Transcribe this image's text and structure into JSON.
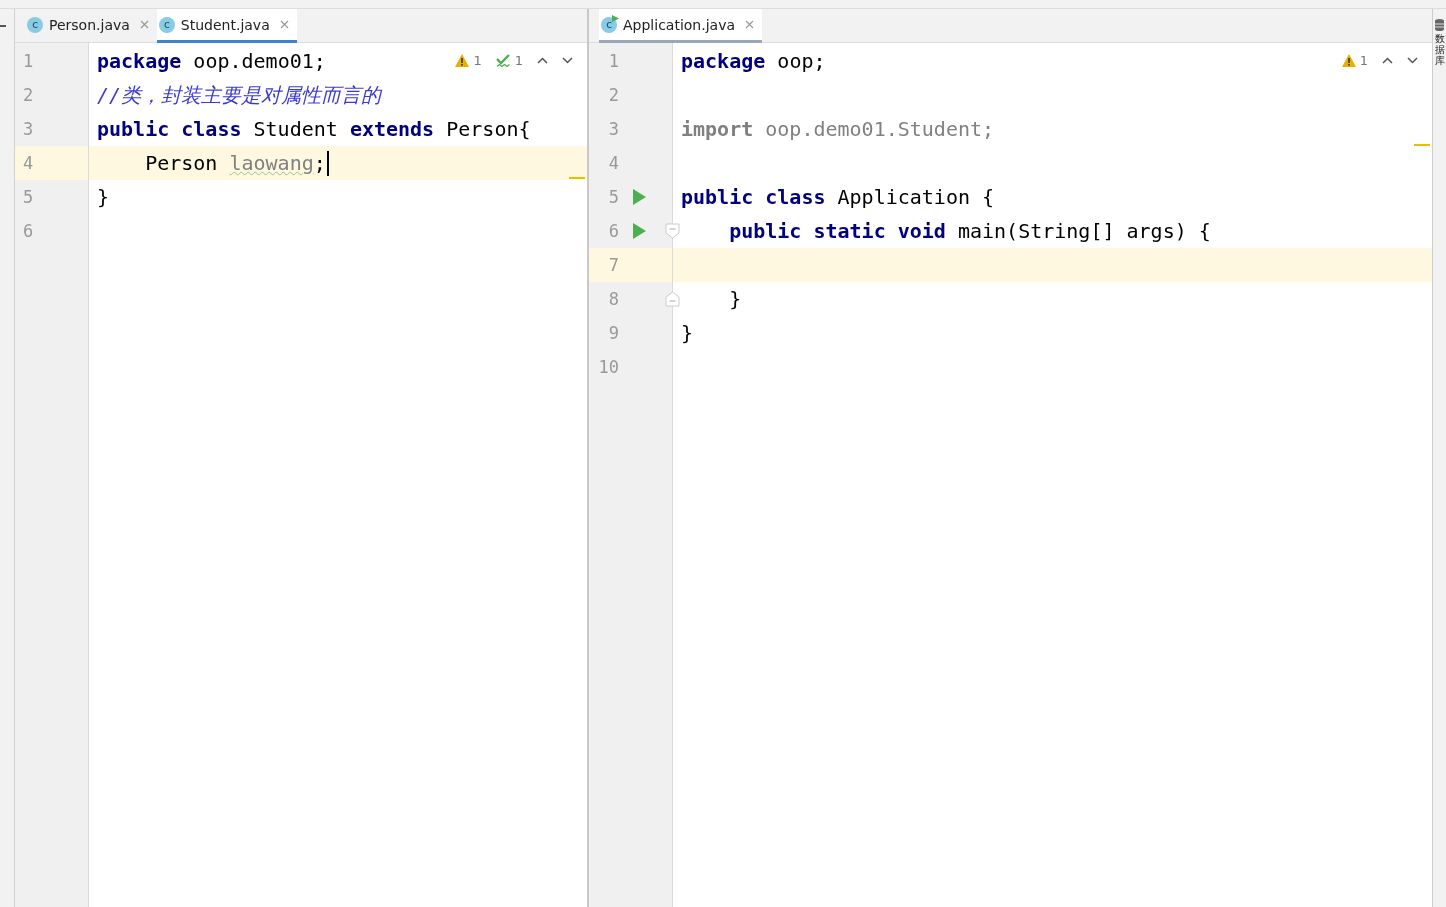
{
  "panes": [
    {
      "focused": true,
      "tabs": [
        {
          "label": "Person.java",
          "icon_text": "c",
          "runnable": false,
          "selected": false
        },
        {
          "label": "Student.java",
          "icon_text": "c",
          "runnable": false,
          "selected": true
        }
      ],
      "inspections": [
        {
          "kind": "warning",
          "count": "1"
        },
        {
          "kind": "typo",
          "count": "1"
        }
      ],
      "lines": [
        {
          "number": "1",
          "current": false,
          "tokens": [
            {
              "kind": "keyword",
              "text": "package"
            },
            {
              "kind": "text",
              "text": " oop.demo01;"
            }
          ]
        },
        {
          "number": "2",
          "current": false,
          "tokens": [
            {
              "kind": "comment",
              "text": "//类，封装主要是对属性而言的"
            }
          ]
        },
        {
          "number": "3",
          "current": false,
          "tokens": [
            {
              "kind": "keyword",
              "text": "public class"
            },
            {
              "kind": "text",
              "text": " Student "
            },
            {
              "kind": "keyword",
              "text": "extends"
            },
            {
              "kind": "text",
              "text": " Person{"
            }
          ]
        },
        {
          "number": "4",
          "current": true,
          "caret": true,
          "tokens": [
            {
              "kind": "text",
              "text": "    Person "
            },
            {
              "kind": "unused_typo",
              "text": "laowang"
            },
            {
              "kind": "text",
              "text": ";"
            }
          ]
        },
        {
          "number": "5",
          "current": false,
          "tokens": [
            {
              "kind": "text",
              "text": "}"
            }
          ]
        },
        {
          "number": "6",
          "current": false
        }
      ]
    },
    {
      "focused": false,
      "tabs": [
        {
          "label": "Application.java",
          "icon_text": "c",
          "runnable": true,
          "selected": true
        }
      ],
      "inspections": [
        {
          "kind": "warning",
          "count": "1"
        }
      ],
      "lines": [
        {
          "number": "1",
          "current": false,
          "tokens": [
            {
              "kind": "keyword",
              "text": "package"
            },
            {
              "kind": "text",
              "text": " oop;"
            }
          ]
        },
        {
          "number": "2",
          "current": false
        },
        {
          "number": "3",
          "current": false,
          "tokens": [
            {
              "kind": "unused_keyword",
              "text": "import"
            },
            {
              "kind": "unused",
              "text": " oop.demo01.Student;"
            }
          ]
        },
        {
          "number": "4",
          "current": false
        },
        {
          "number": "5",
          "current": false,
          "run": true,
          "tokens": [
            {
              "kind": "keyword",
              "text": "public class"
            },
            {
              "kind": "text",
              "text": " Application {"
            }
          ]
        },
        {
          "number": "6",
          "current": false,
          "run": true,
          "fold_start": true,
          "tokens": [
            {
              "kind": "keyword",
              "text": "    public static void"
            },
            {
              "kind": "text",
              "text": " main(String[] args) {"
            }
          ]
        },
        {
          "number": "7",
          "current": true
        },
        {
          "number": "8",
          "current": false,
          "fold_end": true,
          "tokens": [
            {
              "kind": "text",
              "text": "    }"
            }
          ]
        },
        {
          "number": "9",
          "current": false,
          "tokens": [
            {
              "kind": "text",
              "text": "}"
            }
          ]
        },
        {
          "number": "10",
          "current": false
        }
      ]
    }
  ],
  "side_tool": {
    "label": "数据库"
  }
}
